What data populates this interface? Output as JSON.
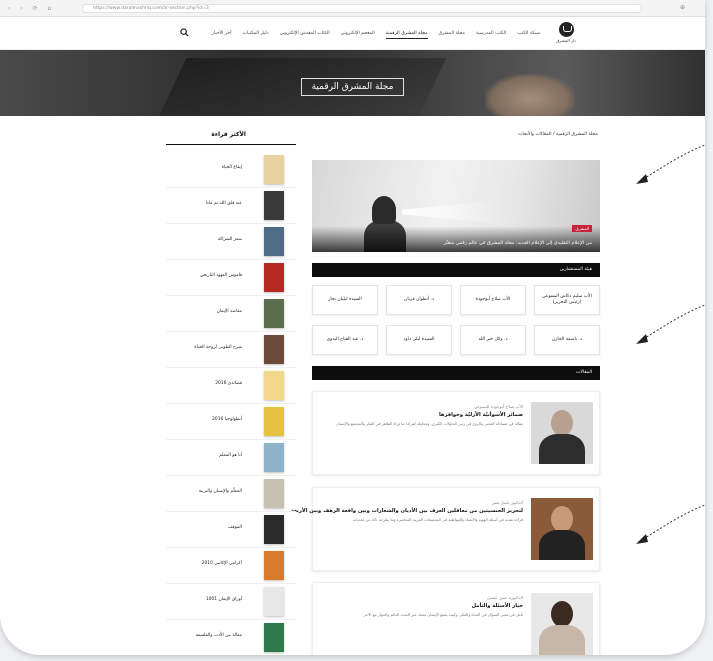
{
  "browser": {
    "url": "https://www.daralmashriq.com/ar-section.php?id=3",
    "nav_glyphs": "‹ › ⟳ ⌂"
  },
  "header": {
    "logo_text": "دار المشرق",
    "menu": [
      "شبكة الكتب",
      "الكتب المدرسية",
      "مجلة المشرق",
      "مجلة المشرق الرقمية",
      "المعجم الإلكتروني",
      "الكتاب المقدس الإلكتروني",
      "دليل المكتبات",
      "آخر الأخبار"
    ],
    "active_index": 3
  },
  "hero": {
    "title": "مجلة المشرق الرقمية"
  },
  "breadcrumb": "مجلة المشرق الرقمية / المقالات والأبحاث",
  "feature": {
    "badge": "المشرق",
    "caption": "من الإعلام التقليدي إلى الإعلام الجديد: مجلة المشرق في عالم رقمي متغيّر"
  },
  "board": {
    "heading": "هيئة المستشارين",
    "members": [
      "الأب سليم دكاش اليسوعي (رئيس التحرير)",
      "الأب صلاح أبوجودة",
      "د. أنطوان قربان",
      "السيدة ليليان نجار",
      "د. باسمة الخازن",
      "د. وائل خير الله",
      "السيدة ليلى داود",
      "د. عبد الفتاح البدوي"
    ]
  },
  "articles": {
    "heading": "المقالات",
    "items": [
      {
        "author": "الأب صلاح أبوجودة اليسوعي",
        "title": "ضمائر الأسوأنيّة الأزليّة وحوافزها",
        "excerpt": "مقالة في مساءلة المعنى والروح في زمن التحوّلات الكبرى، ومحاولة لقراءة ما وراء الظاهر في الفكر والمجتمع والإنسان"
      },
      {
        "author": "الدكتور باسل نصر",
        "title": "لتحرير الجنسيتين من معاقلين العرف بين الأديان والشعارات وبين واقعة الرهف وبين الأربعة",
        "excerpt": "قراءة نقدية في أسئلة الهوية والانتماء والمواطنة في المجتمعات العربية المعاصرة وما يطرحه ذلك من تحديات"
      },
      {
        "author": "الدكتورة حنين عيسى",
        "title": "خيار الأسئلة والتأمل",
        "excerpt": "تأمل في معنى السؤال في الحياة والفكر، وكيف يصنع الإنسان معناه عبر البحث الدائم والحوار مع الآخر"
      }
    ]
  },
  "sidebar": {
    "title": "الأكثر قراءة",
    "items": [
      {
        "name": "إيقاع الحياة",
        "color": "#e8d3a0"
      },
      {
        "name": "عند قلق الله ثم ماذا",
        "color": "#3a3a3a"
      },
      {
        "name": "سعر الشراكة",
        "color": "#4f6b86"
      },
      {
        "name": "قاموس العهود التاريخي",
        "color": "#b52a22"
      },
      {
        "name": "مقاصد الإيمان",
        "color": "#5d6e4e"
      },
      {
        "name": "شرح الطوبى لروحة الحياة",
        "color": "#6b4a3a"
      },
      {
        "name": "قصائدي 2016",
        "color": "#f2d98a"
      },
      {
        "name": "أنطولوجيا 2016",
        "color": "#e5c340"
      },
      {
        "name": "أنا هو المعلم",
        "color": "#8eb3c9"
      },
      {
        "name": "المعلّم والإنسان والتربية",
        "color": "#c8c0b0"
      },
      {
        "name": "الموقف",
        "color": "#2a2a2a"
      },
      {
        "name": "اكرامي الإكاتبي 2010",
        "color": "#d97a2a"
      },
      {
        "name": "أوراق الإيمان 1001",
        "color": "#e7e7e7"
      },
      {
        "name": "مقالة بين الأدب والفلسفة",
        "color": "#2f7a4a"
      }
    ]
  },
  "colors": {
    "accent_red": "#c6223a",
    "bar_black": "#0d0d0d"
  }
}
